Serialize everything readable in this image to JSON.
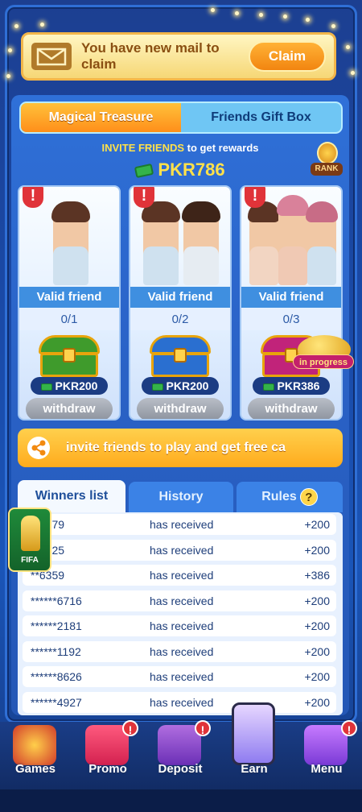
{
  "mail": {
    "text": "You have new mail to claim",
    "claim_label": "Claim"
  },
  "tabs": [
    {
      "label": "Magical Treasure",
      "active": true
    },
    {
      "label": "Friends Gift Box",
      "active": false
    }
  ],
  "invite": {
    "highlight": "INVITE FRIENDS",
    "rest": " to get  rewards"
  },
  "total": "PKR786",
  "rank_label": "RANK",
  "cards": [
    {
      "valid_label": "Valid friend",
      "progress": "0/1",
      "amount": "PKR200",
      "button": "withdraw",
      "chest_color": "#3f9b2c"
    },
    {
      "valid_label": "Valid friend",
      "progress": "0/2",
      "amount": "PKR200",
      "button": "withdraw",
      "chest_color": "#2a6fd0"
    },
    {
      "valid_label": "Valid friend",
      "progress": "0/3",
      "amount": "PKR386",
      "button": "withdraw",
      "chest_color": "#c1237a"
    }
  ],
  "share_text": "invite friends to play and get free ca",
  "lamp_badge": "in progress",
  "list_tabs": [
    {
      "label": "Winners list",
      "active": true
    },
    {
      "label": "History",
      "active": false
    },
    {
      "label": "Rules",
      "active": false
    }
  ],
  "rules_help": "?",
  "winners": [
    {
      "who": "**3779",
      "what": "has received",
      "amount": "+200"
    },
    {
      "who": "**3725",
      "what": "has received",
      "amount": "+200"
    },
    {
      "who": "**6359",
      "what": "has received",
      "amount": "+386"
    },
    {
      "who": "******6716",
      "what": "has received",
      "amount": "+200"
    },
    {
      "who": "******2181",
      "what": "has received",
      "amount": "+200"
    },
    {
      "who": "******1192",
      "what": "has received",
      "amount": "+200"
    },
    {
      "who": "******8626",
      "what": "has received",
      "amount": "+200"
    },
    {
      "who": "******4927",
      "what": "has received",
      "amount": "+200"
    }
  ],
  "fifa_label": "FIFA",
  "nav": [
    {
      "label": "Games",
      "badge": ""
    },
    {
      "label": "Promo",
      "badge": "!"
    },
    {
      "label": "Deposit",
      "badge": "!"
    },
    {
      "label": "Earn",
      "badge": ""
    },
    {
      "label": "Menu",
      "badge": "!"
    }
  ],
  "colors": {
    "accent": "#ffb236",
    "panel": "#2a62c6",
    "warn": "#e03339"
  }
}
